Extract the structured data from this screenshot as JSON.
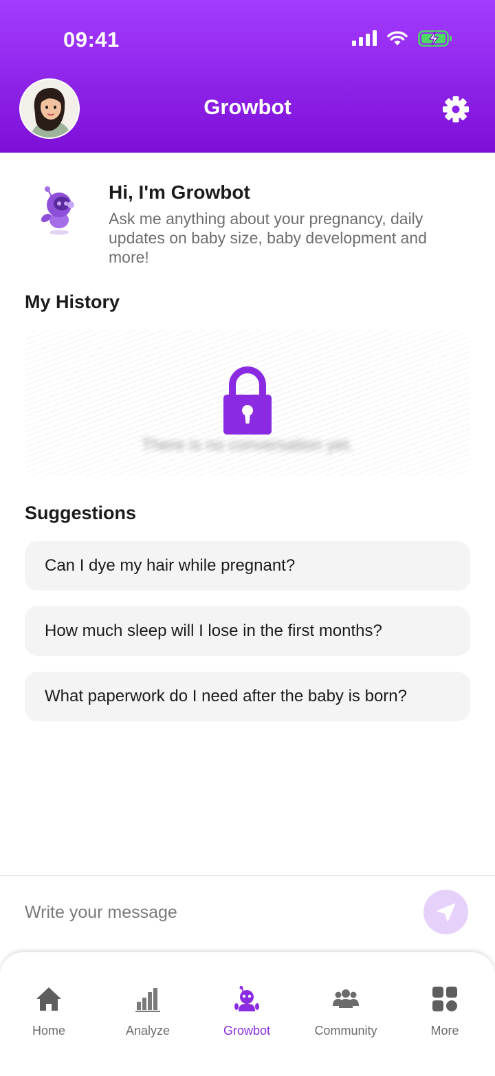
{
  "status_bar": {
    "time": "09:41"
  },
  "header": {
    "title": "Growbot"
  },
  "intro": {
    "title": "Hi, I'm Growbot",
    "text": "Ask me anything about your pregnancy, daily updates on baby size, baby development and more!"
  },
  "history": {
    "title": "My History",
    "empty_text": "There is no conversation yet."
  },
  "suggestions": {
    "title": "Suggestions",
    "items": [
      "Can I dye my hair while pregnant?",
      "How much sleep will I lose in the first months?",
      "What paperwork do I need after the baby is born?"
    ]
  },
  "composer": {
    "placeholder": "Write your message"
  },
  "tabs": [
    {
      "label": "Home",
      "icon": "home-icon"
    },
    {
      "label": "Analyze",
      "icon": "bar-chart-icon"
    },
    {
      "label": "Growbot",
      "icon": "robot-icon",
      "active": true
    },
    {
      "label": "Community",
      "icon": "community-icon"
    },
    {
      "label": "More",
      "icon": "grid-icon"
    }
  ],
  "colors": {
    "brand_purple": "#8a2be2",
    "header_gradient_top": "#a33cff",
    "header_gradient_bottom": "#7d0fd6",
    "send_button": "#e6d1fb",
    "battery_green": "#4cd964"
  }
}
